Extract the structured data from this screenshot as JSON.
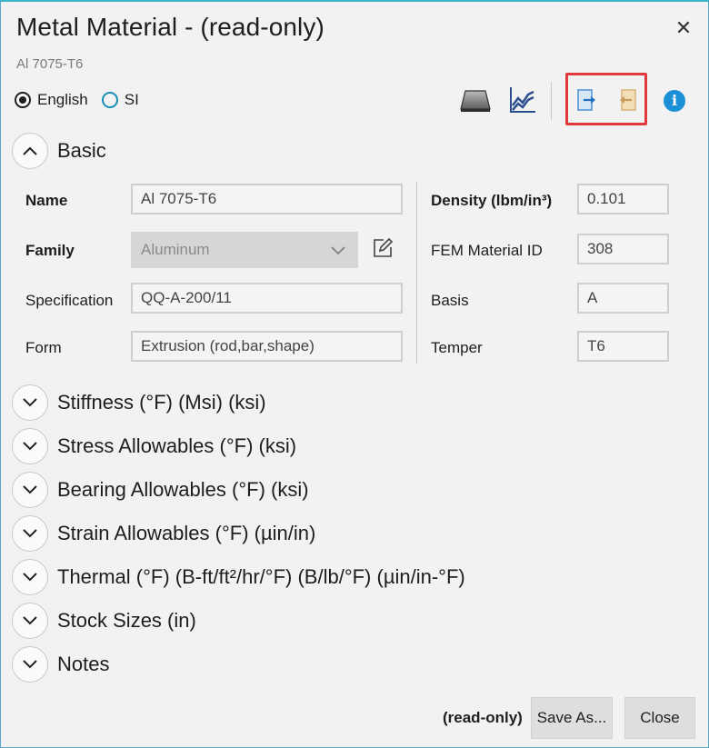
{
  "dialog": {
    "title": "Metal Material - (read-only)",
    "subtitle": "Al 7075-T6",
    "close_glyph": "✕"
  },
  "units": {
    "options": [
      {
        "label": "English",
        "selected": true
      },
      {
        "label": "SI",
        "selected": false
      }
    ]
  },
  "toolbar": {
    "icons": [
      "material-block-icon",
      "chart-icon",
      "export-icon",
      "import-icon",
      "info-icon"
    ],
    "info_glyph": "i",
    "accent": "#1c90d6",
    "highlight_color": "#e0393e"
  },
  "basic": {
    "title": "Basic",
    "name_label": "Name",
    "name_value": "Al 7075-T6",
    "family_label": "Family",
    "family_value": "Aluminum",
    "spec_label": "Specification",
    "spec_value": "QQ-A-200/11",
    "form_label": "Form",
    "form_value": "Extrusion (rod,bar,shape)",
    "density_label": "Density (lbm/in³)",
    "density_value": "0.101",
    "fem_label": "FEM Material ID",
    "fem_value": "308",
    "basis_label": "Basis",
    "basis_value": "A",
    "temper_label": "Temper",
    "temper_value": "T6"
  },
  "sections": [
    "Stiffness (°F) (Msi) (ksi)",
    "Stress Allowables (°F) (ksi)",
    "Bearing Allowables (°F) (ksi)",
    "Strain Allowables (°F) (µin/in)",
    "Thermal (°F) (B-ft/ft²/hr/°F) (B/lb/°F) (µin/in-°F)",
    "Stock Sizes (in)",
    "Notes"
  ],
  "footer": {
    "status": "(read-only)",
    "save_as": "Save As...",
    "close": "Close"
  }
}
